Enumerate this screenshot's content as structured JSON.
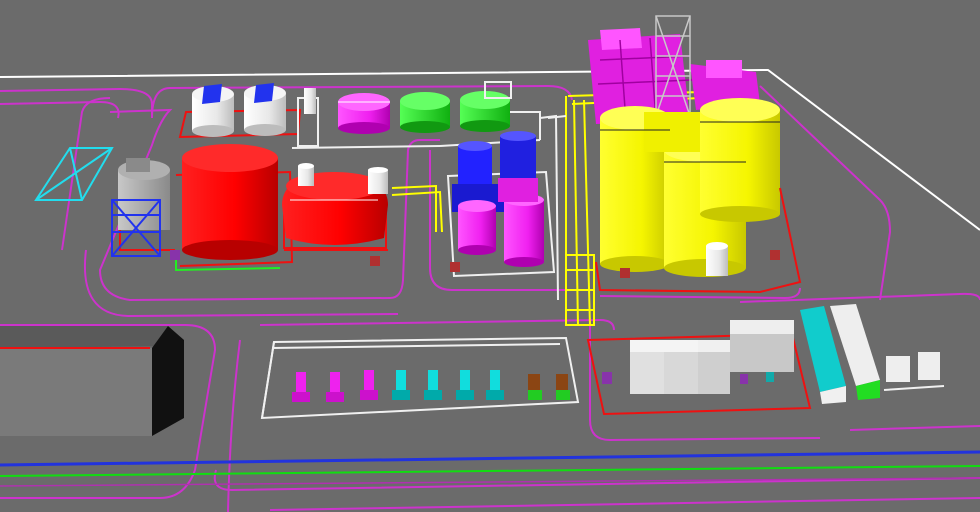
{
  "scene": {
    "background": "#6b6b6b",
    "colors": {
      "ground_line": "#ffffff",
      "road_edge": "#cc33cc",
      "red_tank": "#ff0000",
      "red_dark": "#b00000",
      "yellow_silo": "#ffff00",
      "yellow_dark": "#c8c800",
      "magenta_tank": "#ff33ff",
      "magenta_dark": "#c000c0",
      "green_tank": "#22ee22",
      "blue_tank": "#2222ff",
      "cyan_unit": "#11cccc",
      "white_unit": "#eeeeee",
      "grey_unit": "#cfcfcf",
      "black_wall": "#111111",
      "blue_pipe": "#2233dd",
      "green_pipe": "#11dd11",
      "helipad": "#22ddee"
    }
  }
}
